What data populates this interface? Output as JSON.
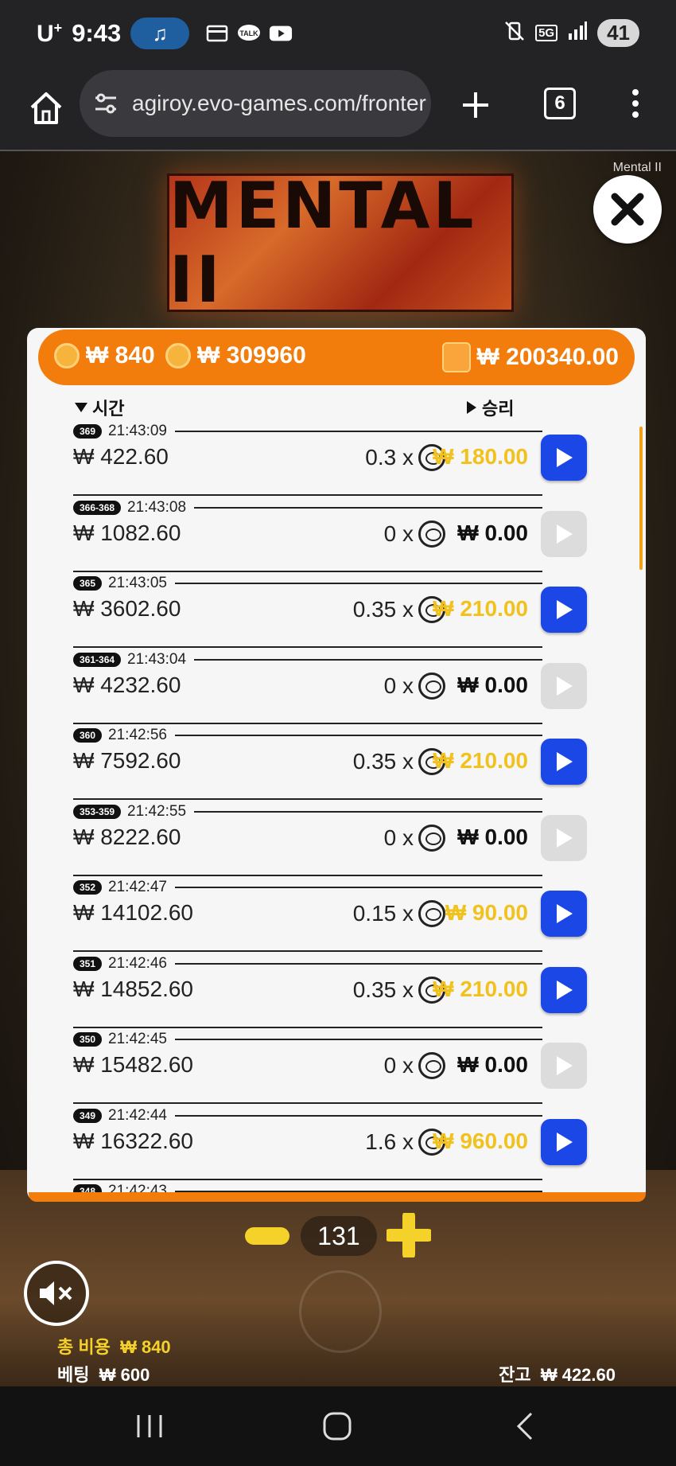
{
  "status_bar": {
    "carrier": "U",
    "carrier_sup": "+",
    "time": "9:43",
    "network": "5G",
    "battery": "41"
  },
  "browser": {
    "url": "agiroy.evo-games.com/fronter",
    "tab_count": "6"
  },
  "game": {
    "name": "Mental II",
    "logo_text": "MENTAL II",
    "top_bar": {
      "bet_cost": "₩ 840",
      "total_cost": "₩ 309960",
      "wallet": "₩ 200340.00"
    },
    "headers": {
      "time": "시간",
      "win": "승리"
    },
    "rows": [
      {
        "badge": "369",
        "time": "21:43:09",
        "amount": "₩ 422.60",
        "mult": "0.3 x",
        "win": "₩ 180.00",
        "gold": true
      },
      {
        "badge": "366-368",
        "time": "21:43:08",
        "amount": "₩ 1082.60",
        "mult": "0 x",
        "win": "₩ 0.00",
        "gold": false
      },
      {
        "badge": "365",
        "time": "21:43:05",
        "amount": "₩ 3602.60",
        "mult": "0.35 x",
        "win": "₩ 210.00",
        "gold": true
      },
      {
        "badge": "361-364",
        "time": "21:43:04",
        "amount": "₩ 4232.60",
        "mult": "0 x",
        "win": "₩ 0.00",
        "gold": false
      },
      {
        "badge": "360",
        "time": "21:42:56",
        "amount": "₩ 7592.60",
        "mult": "0.35 x",
        "win": "₩ 210.00",
        "gold": true
      },
      {
        "badge": "353-359",
        "time": "21:42:55",
        "amount": "₩ 8222.60",
        "mult": "0 x",
        "win": "₩ 0.00",
        "gold": false
      },
      {
        "badge": "352",
        "time": "21:42:47",
        "amount": "₩ 14102.60",
        "mult": "0.15 x",
        "win": "₩ 90.00",
        "gold": true
      },
      {
        "badge": "351",
        "time": "21:42:46",
        "amount": "₩ 14852.60",
        "mult": "0.35 x",
        "win": "₩ 210.00",
        "gold": true
      },
      {
        "badge": "350",
        "time": "21:42:45",
        "amount": "₩ 15482.60",
        "mult": "0 x",
        "win": "₩ 0.00",
        "gold": false
      },
      {
        "badge": "349",
        "time": "21:42:44",
        "amount": "₩ 16322.60",
        "mult": "1.6 x",
        "win": "₩ 960.00",
        "gold": true
      },
      {
        "badge": "348",
        "time": "21:42:43",
        "amount": "",
        "mult": "",
        "win": "",
        "gold": false
      }
    ],
    "spin_count": "131",
    "total_cost_label": "총 비용",
    "total_cost_value": "₩ 840",
    "bet_label": "베팅",
    "bet_value": "₩ 600",
    "balance_label": "잔고",
    "balance_value": "₩ 422.60"
  },
  "colors": {
    "accent_orange": "#f27d0c",
    "play_blue": "#1b47e6",
    "win_gold": "#f1c21e"
  },
  "icons": [
    "home-icon",
    "site-settings-icon",
    "plus-icon",
    "menu-dots-icon",
    "close-icon",
    "coin-icon",
    "wallet-icon",
    "chip-icon",
    "play-icon",
    "mute-icon",
    "recents-icon",
    "home-nav-icon",
    "back-icon"
  ]
}
